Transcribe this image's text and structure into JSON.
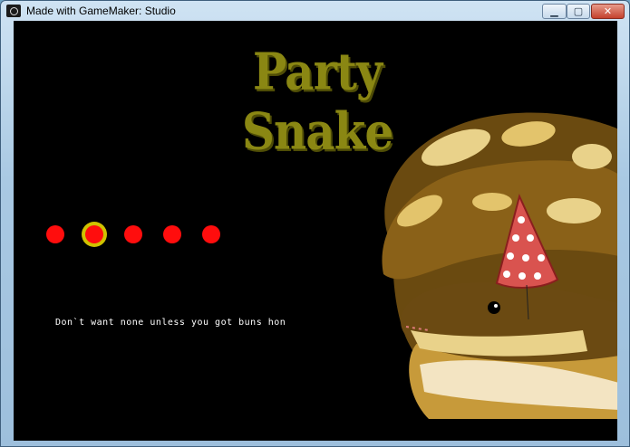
{
  "window": {
    "title": "Made with GameMaker: Studio",
    "controls": {
      "minimize": "▁",
      "maximize": "▢",
      "close": "✕"
    }
  },
  "game": {
    "title": "Party Snake",
    "dialogue": "Don`t want none unless you got buns hon",
    "options": {
      "count": 5,
      "selected_index": 1
    },
    "colors": {
      "title": "#8a8713",
      "option": "#ff0d0d",
      "selection_ring": "#d0c200",
      "background": "#000000"
    }
  }
}
